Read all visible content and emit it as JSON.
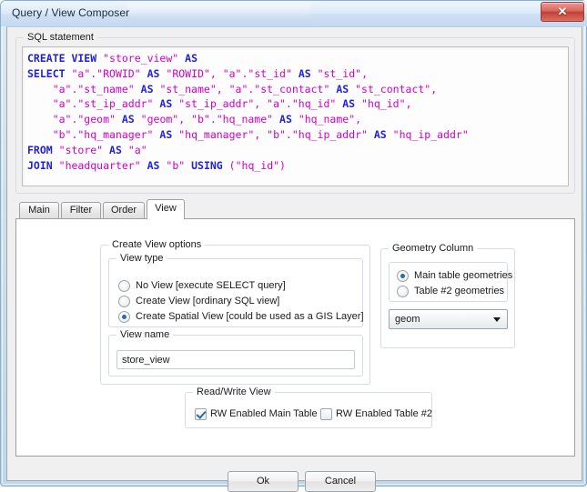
{
  "window": {
    "title": "Query / View Composer",
    "close_label": "✕"
  },
  "sql_group": {
    "title": "SQL statement",
    "lines": [
      [
        {
          "t": "CREATE VIEW",
          "c": "kw"
        },
        {
          "t": " ",
          "c": "pl"
        },
        {
          "t": "\"store_view\"",
          "c": "id"
        },
        {
          "t": " ",
          "c": "pl"
        },
        {
          "t": "AS",
          "c": "kw"
        }
      ],
      [
        {
          "t": "SELECT",
          "c": "kw"
        },
        {
          "t": " ",
          "c": "pl"
        },
        {
          "t": "\"a\".\"ROWID\"",
          "c": "id"
        },
        {
          "t": " ",
          "c": "pl"
        },
        {
          "t": "AS",
          "c": "kw"
        },
        {
          "t": " ",
          "c": "pl"
        },
        {
          "t": "\"ROWID\", \"a\".\"st_id\"",
          "c": "id"
        },
        {
          "t": " ",
          "c": "pl"
        },
        {
          "t": "AS",
          "c": "kw"
        },
        {
          "t": " ",
          "c": "pl"
        },
        {
          "t": "\"st_id\",",
          "c": "id"
        }
      ],
      [
        {
          "t": "    \"a\".\"st_name\"",
          "c": "id"
        },
        {
          "t": " ",
          "c": "pl"
        },
        {
          "t": "AS",
          "c": "kw"
        },
        {
          "t": " ",
          "c": "pl"
        },
        {
          "t": "\"st_name\", \"a\".\"st_contact\"",
          "c": "id"
        },
        {
          "t": " ",
          "c": "pl"
        },
        {
          "t": "AS",
          "c": "kw"
        },
        {
          "t": " ",
          "c": "pl"
        },
        {
          "t": "\"st_contact\",",
          "c": "id"
        }
      ],
      [
        {
          "t": "    \"a\".\"st_ip_addr\"",
          "c": "id"
        },
        {
          "t": " ",
          "c": "pl"
        },
        {
          "t": "AS",
          "c": "kw"
        },
        {
          "t": " ",
          "c": "pl"
        },
        {
          "t": "\"st_ip_addr\", \"a\".\"hq_id\"",
          "c": "id"
        },
        {
          "t": " ",
          "c": "pl"
        },
        {
          "t": "AS",
          "c": "kw"
        },
        {
          "t": " ",
          "c": "pl"
        },
        {
          "t": "\"hq_id\",",
          "c": "id"
        }
      ],
      [
        {
          "t": "    \"a\".\"geom\"",
          "c": "id"
        },
        {
          "t": " ",
          "c": "pl"
        },
        {
          "t": "AS",
          "c": "kw"
        },
        {
          "t": " ",
          "c": "pl"
        },
        {
          "t": "\"geom\", \"b\".\"hq_name\"",
          "c": "id"
        },
        {
          "t": " ",
          "c": "pl"
        },
        {
          "t": "AS",
          "c": "kw"
        },
        {
          "t": " ",
          "c": "pl"
        },
        {
          "t": "\"hq_name\",",
          "c": "id"
        }
      ],
      [
        {
          "t": "    \"b\".\"hq_manager\"",
          "c": "id"
        },
        {
          "t": " ",
          "c": "pl"
        },
        {
          "t": "AS",
          "c": "kw"
        },
        {
          "t": " ",
          "c": "pl"
        },
        {
          "t": "\"hq_manager\", \"b\".\"hq_ip_addr\"",
          "c": "id"
        },
        {
          "t": " ",
          "c": "pl"
        },
        {
          "t": "AS",
          "c": "kw"
        },
        {
          "t": " ",
          "c": "pl"
        },
        {
          "t": "\"hq_ip_addr\"",
          "c": "id"
        }
      ],
      [
        {
          "t": "FROM",
          "c": "kw"
        },
        {
          "t": " ",
          "c": "pl"
        },
        {
          "t": "\"store\"",
          "c": "id"
        },
        {
          "t": " ",
          "c": "pl"
        },
        {
          "t": "AS",
          "c": "kw"
        },
        {
          "t": " ",
          "c": "pl"
        },
        {
          "t": "\"a\"",
          "c": "id"
        }
      ],
      [
        {
          "t": "JOIN",
          "c": "kw"
        },
        {
          "t": " ",
          "c": "pl"
        },
        {
          "t": "\"headquarter\"",
          "c": "id"
        },
        {
          "t": " ",
          "c": "pl"
        },
        {
          "t": "AS",
          "c": "kw"
        },
        {
          "t": " ",
          "c": "pl"
        },
        {
          "t": "\"b\"",
          "c": "id"
        },
        {
          "t": " ",
          "c": "pl"
        },
        {
          "t": "USING",
          "c": "kw"
        },
        {
          "t": " ",
          "c": "pl"
        },
        {
          "t": "(\"hq_id\")",
          "c": "id"
        }
      ]
    ],
    "colors": {
      "keyword": "#2020e0",
      "identifier": "#cc00cc"
    }
  },
  "tabs": [
    {
      "label": "Main",
      "active": false
    },
    {
      "label": "Filter",
      "active": false
    },
    {
      "label": "Order",
      "active": false
    },
    {
      "label": "View",
      "active": true
    }
  ],
  "view_tab": {
    "create_view_options": {
      "title": "Create View options",
      "view_type": {
        "title": "View type",
        "options": [
          {
            "label": "No View [execute SELECT query]",
            "checked": false
          },
          {
            "label": "Create View [ordinary SQL view]",
            "checked": false
          },
          {
            "label": "Create Spatial View [could be used as a GIS Layer]",
            "checked": true
          }
        ]
      },
      "view_name": {
        "title": "View name",
        "value": "store_view",
        "placeholder": ""
      }
    },
    "geometry_column": {
      "title": "Geometry Column",
      "options": [
        {
          "label": "Main table geometries",
          "checked": true
        },
        {
          "label": "Table #2 geometries",
          "checked": false
        }
      ],
      "combo_value": "geom"
    },
    "read_write_view": {
      "title": "Read/Write View",
      "checkboxes": [
        {
          "label": "RW Enabled Main Table",
          "checked": true
        },
        {
          "label": "RW Enabled Table #2",
          "checked": false
        }
      ]
    }
  },
  "footer": {
    "ok_label": "Ok",
    "cancel_label": "Cancel"
  }
}
